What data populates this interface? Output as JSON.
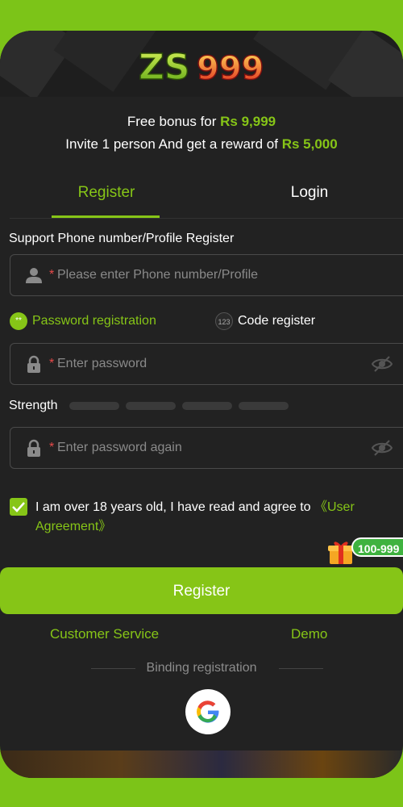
{
  "brand": {
    "logo_text": "ZS999"
  },
  "promo": {
    "line1_prefix": "Free bonus for ",
    "line1_amount": "Rs 9,999",
    "line2_prefix": "Invite 1 person And get a reward of ",
    "line2_amount": "Rs 5,000"
  },
  "tabs": [
    {
      "label": "Register",
      "active": true
    },
    {
      "label": "Login",
      "active": false
    }
  ],
  "form": {
    "section_label": "Support Phone number/Profile Register",
    "required_mark": "*",
    "phone_placeholder": "Please enter Phone number/Profile",
    "password_placeholder": "Enter password",
    "password_again_placeholder": "Enter password again",
    "strength_label": "Strength",
    "strength_level": 0
  },
  "modes": [
    {
      "label": "Password registration",
      "badge": "**",
      "selected": true
    },
    {
      "label": "Code register",
      "badge": "123",
      "selected": false
    }
  ],
  "agreement": {
    "checked": true,
    "text": "I am over 18 years old, I have read and agree to ",
    "link_text": "《User Agreement》"
  },
  "gift_badge": "100-999",
  "register_button": "Register",
  "footer_links": {
    "customer_service": "Customer Service",
    "demo": "Demo"
  },
  "binding": {
    "label": "Binding registration",
    "provider": "google-icon"
  },
  "colors": {
    "accent": "#86c517",
    "background": "#222222",
    "outer": "#7cc418"
  }
}
